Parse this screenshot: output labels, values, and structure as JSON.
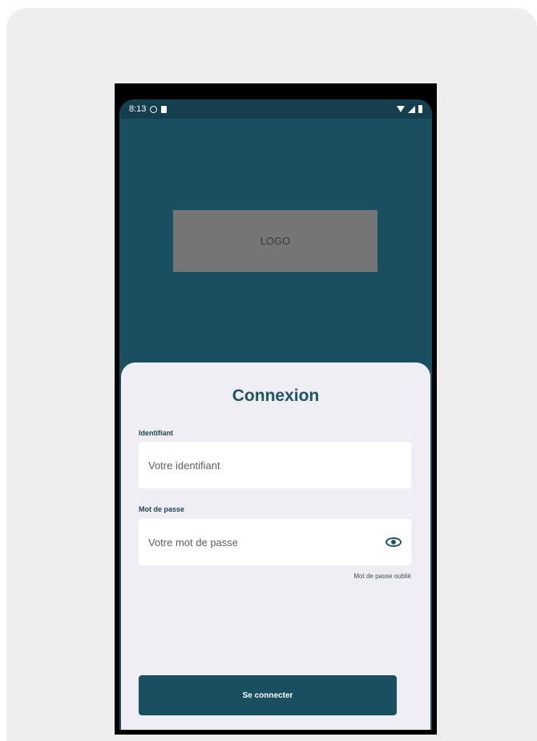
{
  "status_bar": {
    "time": "8:13",
    "left_icons": [
      "globe-icon",
      "sim-icon"
    ],
    "right_icons": [
      "wifi-icon",
      "signal-icon",
      "battery-icon"
    ]
  },
  "logo": {
    "text": "LOGO"
  },
  "login": {
    "title": "Connexion",
    "identifier": {
      "label": "Identifiant",
      "placeholder": "Votre identifiant"
    },
    "password": {
      "label": "Mot de passe",
      "placeholder": "Votre mot de passe",
      "toggle_icon": "eye-icon"
    },
    "forgot_label": "Mot de passe oublié",
    "submit_label": "Se connecter"
  },
  "colors": {
    "primary": "#184f61",
    "sheet": "#efeef4",
    "logo_bg": "#757575"
  }
}
